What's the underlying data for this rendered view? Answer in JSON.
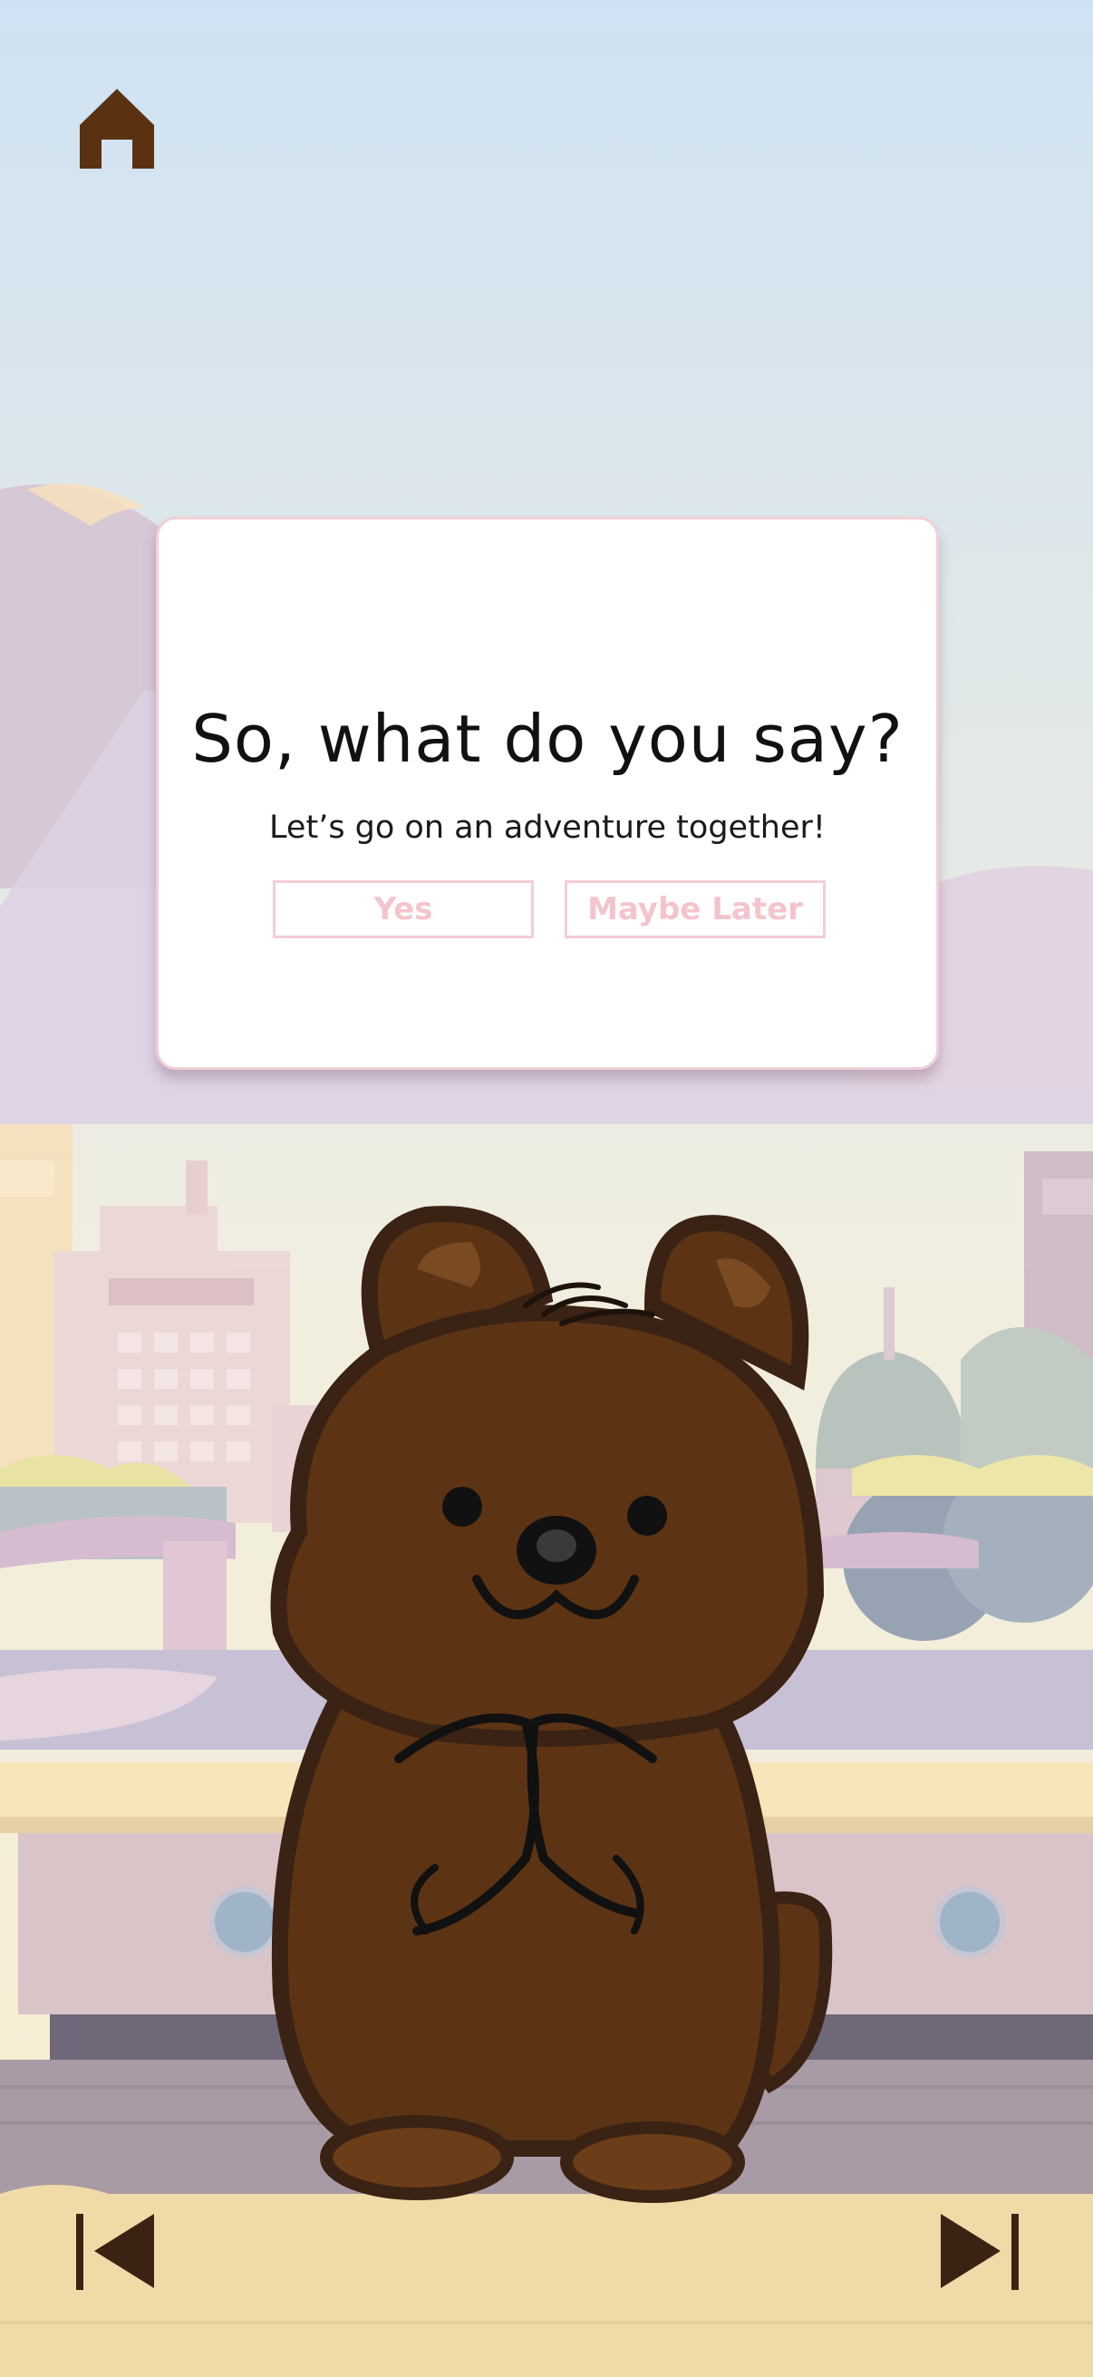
{
  "dialog": {
    "title": "So, what do you say?",
    "subtitle": "Let’s go on an adventure together!",
    "yes_label": "Yes",
    "later_label": "Maybe Later"
  },
  "icons": {
    "home": "home-icon",
    "previous": "skip-previous-icon",
    "next": "skip-next-icon"
  },
  "colors": {
    "sky_top": "#cfe2f3",
    "sky_bottom": "#f6ecd6",
    "bear_fur": "#5c3414",
    "bear_outline": "#3a2314",
    "button_text": "#f4c4cc",
    "button_border": "#f4cdd4",
    "dialog_border": "#f2cfd6",
    "nav_icon": "#3b2314"
  }
}
